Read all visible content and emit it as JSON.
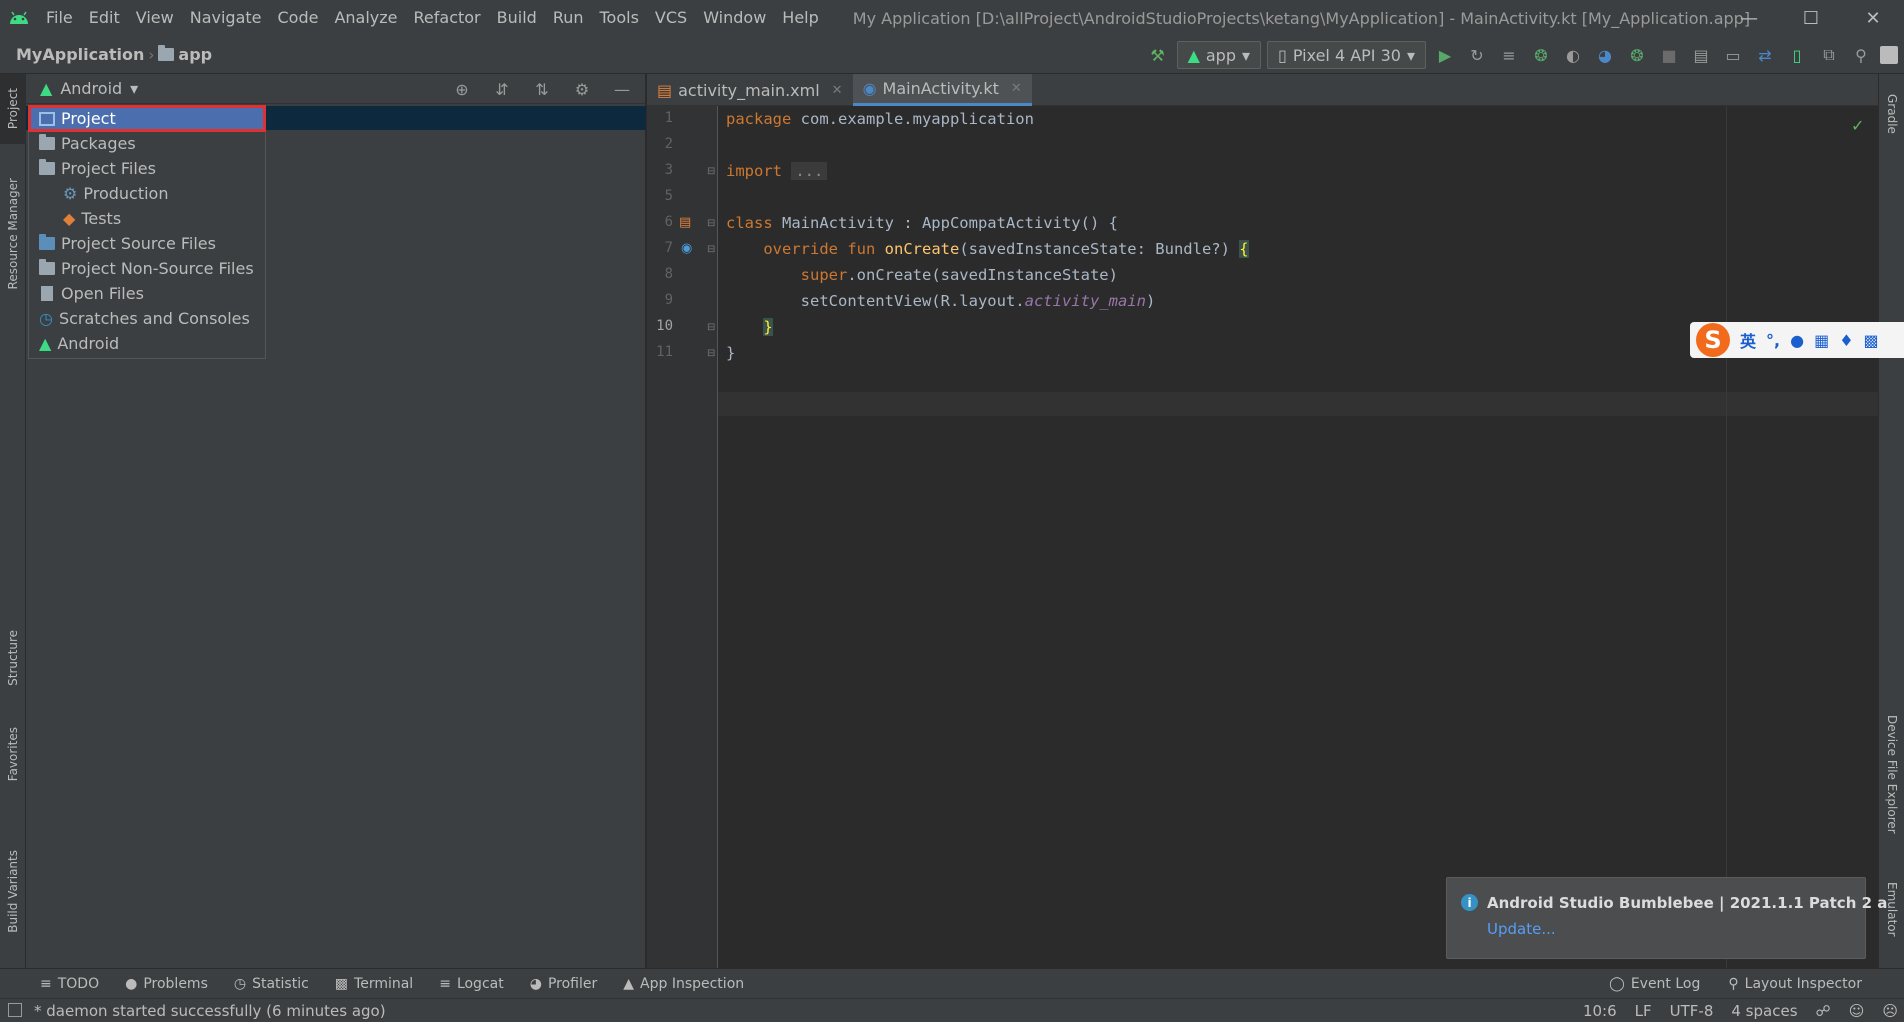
{
  "menubar": {
    "items": [
      "File",
      "Edit",
      "View",
      "Navigate",
      "Code",
      "Analyze",
      "Refactor",
      "Build",
      "Run",
      "Tools",
      "VCS",
      "Window",
      "Help"
    ],
    "window_title": "My Application [D:\\allProject\\AndroidStudioProjects\\ketang\\MyApplication] - MainActivity.kt [My_Application.app]"
  },
  "navbar": {
    "project": "MyApplication",
    "module": "app",
    "run_config": "app",
    "device": "Pixel 4 API 30"
  },
  "left_strip": {
    "project": "Project",
    "resource_manager": "Resource Manager",
    "structure": "Structure",
    "favorites": "Favorites",
    "build_variants": "Build Variants"
  },
  "right_strip": {
    "gradle": "Gradle",
    "device_file_explorer": "Device File Explorer",
    "emulator": "Emulator"
  },
  "project_panel": {
    "view_label": "Android",
    "dropdown": [
      {
        "label": "Project",
        "icon": "project-icon"
      },
      {
        "label": "Packages",
        "icon": "folder-icon"
      },
      {
        "label": "Project Files",
        "icon": "folder-icon"
      },
      {
        "label": "Production",
        "icon": "production-icon"
      },
      {
        "label": "Tests",
        "icon": "tests-icon"
      },
      {
        "label": "Project Source Files",
        "icon": "folder-icon"
      },
      {
        "label": "Project Non-Source Files",
        "icon": "folder-icon"
      },
      {
        "label": "Open Files",
        "icon": "file-icon"
      },
      {
        "label": "Scratches and Consoles",
        "icon": "scratches-icon"
      },
      {
        "label": "Android",
        "icon": "android-icon"
      }
    ],
    "selected": "Project"
  },
  "editor": {
    "tabs": [
      {
        "label": "activity_main.xml",
        "active": false
      },
      {
        "label": "MainActivity.kt",
        "active": true
      }
    ],
    "line_numbers": [
      "1",
      "2",
      "3",
      "5",
      "6",
      "7",
      "8",
      "9",
      "10",
      "11"
    ],
    "code": {
      "l1_kw": "package",
      "l1_rest": " com.example.myapplication",
      "l3_kw": "import",
      "l3_fold": "...",
      "l6_kw": "class",
      "l6_rest": " MainActivity : AppCompatActivity() {",
      "l7_kw": "override fun",
      "l7_fn": "onCreate",
      "l7_rest": "(savedInstanceState: Bundle?) ",
      "l7_brace": "{",
      "l8_kw": "super",
      "l8_rest": ".onCreate(savedInstanceState)",
      "l9_rest": "setContentView(R.layout.",
      "l9_it": "activity_main",
      "l9_end": ")",
      "l10_brace": "}",
      "l11": "}"
    }
  },
  "notification": {
    "title": "Android Studio Bumblebee | 2021.1.1 Patch 2 a",
    "link": "Update..."
  },
  "ime": {
    "logo": "S",
    "mode": "英"
  },
  "bottom_tools": {
    "todo": "TODO",
    "problems": "Problems",
    "statistic": "Statistic",
    "terminal": "Terminal",
    "logcat": "Logcat",
    "profiler": "Profiler",
    "app_inspection": "App Inspection",
    "event_log": "Event Log",
    "layout_inspector": "Layout Inspector"
  },
  "status_bar": {
    "message": "* daemon started successfully (6 minutes ago)",
    "position": "10:6",
    "line_sep": "LF",
    "encoding": "UTF-8",
    "indent": "4 spaces"
  }
}
